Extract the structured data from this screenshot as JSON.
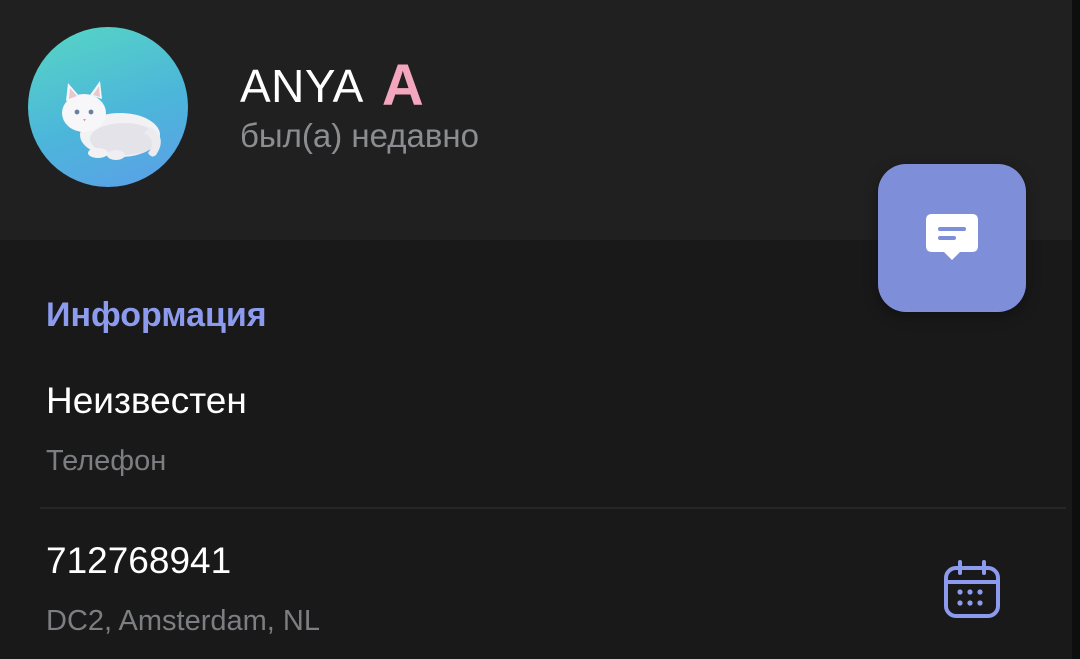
{
  "profile": {
    "name": "ANYA",
    "name_badge": "A",
    "status": "был(а) недавно",
    "avatar_icon": "white-cat-avatar"
  },
  "actions": {
    "message_button_icon": "chat-bubble-icon"
  },
  "info": {
    "section_title": "Информация",
    "phone_value": "Неизвестен",
    "phone_label": "Телефон",
    "id_value": "712768941",
    "id_label": "DC2, Amsterdam, NL",
    "id_action_icon": "calendar-icon"
  },
  "colors": {
    "background": "#191919",
    "header_background": "#202021",
    "accent": "#8d9bef",
    "fab": "#7f8ed8",
    "badge": "#f3a6bd"
  }
}
